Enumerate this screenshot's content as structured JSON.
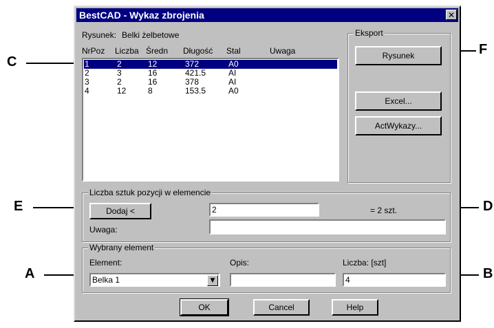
{
  "dialog": {
    "title": "BestCAD - Wykaz zbrojenia",
    "close_glyph": "✕",
    "drawing_label": "Rysunek:",
    "drawing_name": "Belki żelbetowe"
  },
  "table": {
    "headers": [
      "NrPoz",
      "Liczba",
      "Średn",
      "Długość",
      "Stal",
      "Uwaga"
    ],
    "rows": [
      {
        "nr": "1",
        "liczba": "2",
        "sredn": "12",
        "dlugosc": "372",
        "stal": "A0",
        "uwaga": ""
      },
      {
        "nr": "2",
        "liczba": "3",
        "sredn": "16",
        "dlugosc": "421.5",
        "stal": "AI",
        "uwaga": ""
      },
      {
        "nr": "3",
        "liczba": "2",
        "sredn": "16",
        "dlugosc": "378",
        "stal": "AI",
        "uwaga": ""
      },
      {
        "nr": "4",
        "liczba": "12",
        "sredn": "8",
        "dlugosc": "153.5",
        "stal": "A0",
        "uwaga": ""
      }
    ],
    "selected_index": 0
  },
  "export": {
    "group_label": "Eksport",
    "rysunek_button": "Rysunek",
    "excel_button": "Excel...",
    "actwykazy_button": "ActWykazy..."
  },
  "pieces": {
    "group_label": "Liczba sztuk pozycji w elemencie",
    "add_button": "Dodaj <",
    "count_value": "2",
    "count_suffix": "= 2 szt.",
    "note_label": "Uwaga:",
    "note_value": ""
  },
  "selected_element": {
    "group_label": "Wybrany element",
    "element_label": "Element:",
    "element_value": "Belka 1",
    "opis_label": "Opis:",
    "opis_value": "",
    "liczba_label": "Liczba: [szt]",
    "liczba_value": "4"
  },
  "buttons": {
    "ok": "OK",
    "cancel": "Cancel",
    "help": "Help"
  },
  "callouts": {
    "a": "A",
    "b": "B",
    "c": "C",
    "d": "D",
    "e": "E",
    "f": "F"
  },
  "colors": {
    "title_bar": "#000080",
    "selection": "#000080",
    "face": "#c0c0c0"
  }
}
